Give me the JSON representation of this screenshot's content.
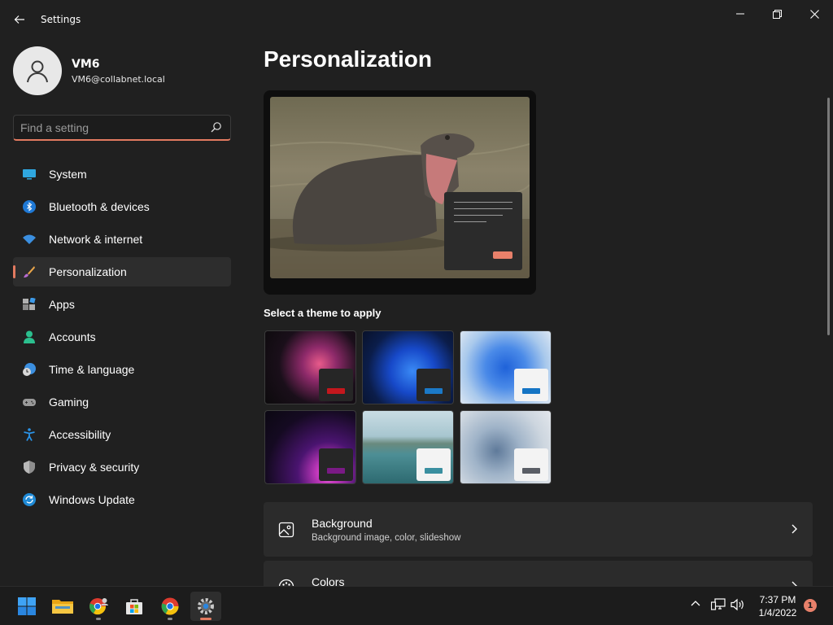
{
  "window": {
    "title": "Settings"
  },
  "profile": {
    "name": "VM6",
    "email": "VM6@collabnet.local"
  },
  "search": {
    "placeholder": "Find a setting"
  },
  "sidebar": {
    "items": [
      {
        "label": "System",
        "icon": "monitor-icon"
      },
      {
        "label": "Bluetooth & devices",
        "icon": "bluetooth-icon"
      },
      {
        "label": "Network & internet",
        "icon": "wifi-icon"
      },
      {
        "label": "Personalization",
        "icon": "brush-icon",
        "selected": true
      },
      {
        "label": "Apps",
        "icon": "apps-icon"
      },
      {
        "label": "Accounts",
        "icon": "person-icon"
      },
      {
        "label": "Time & language",
        "icon": "clock-globe-icon"
      },
      {
        "label": "Gaming",
        "icon": "gamepad-icon"
      },
      {
        "label": "Accessibility",
        "icon": "accessibility-icon"
      },
      {
        "label": "Privacy & security",
        "icon": "shield-icon"
      },
      {
        "label": "Windows Update",
        "icon": "update-icon"
      }
    ]
  },
  "main": {
    "title": "Personalization",
    "theme_section_label": "Select a theme to apply",
    "themes": [
      {
        "name": "glow",
        "accent": "#c4171d"
      },
      {
        "name": "windows-dark",
        "accent": "#1b79c7"
      },
      {
        "name": "windows-light",
        "accent": "#1474c4"
      },
      {
        "name": "captured-motion",
        "accent": "#7a1a85"
      },
      {
        "name": "sunrise-lake",
        "accent": "#3a8fa0"
      },
      {
        "name": "flow",
        "accent": "#5a5e66"
      }
    ],
    "rows": [
      {
        "title": "Background",
        "subtitle": "Background image, color, slideshow",
        "icon": "image-icon"
      },
      {
        "title": "Colors",
        "subtitle": "",
        "icon": "palette-icon"
      }
    ]
  },
  "taskbar": {
    "apps": [
      "start-icon",
      "file-explorer-icon",
      "chrome-user-icon",
      "store-icon",
      "chrome-icon",
      "settings-icon"
    ],
    "time": "7:37 PM",
    "date": "1/4/2022",
    "notifications": "1"
  },
  "colors": {
    "accent": "#e27a60",
    "background": "#202020",
    "card": "#2b2b2b"
  }
}
